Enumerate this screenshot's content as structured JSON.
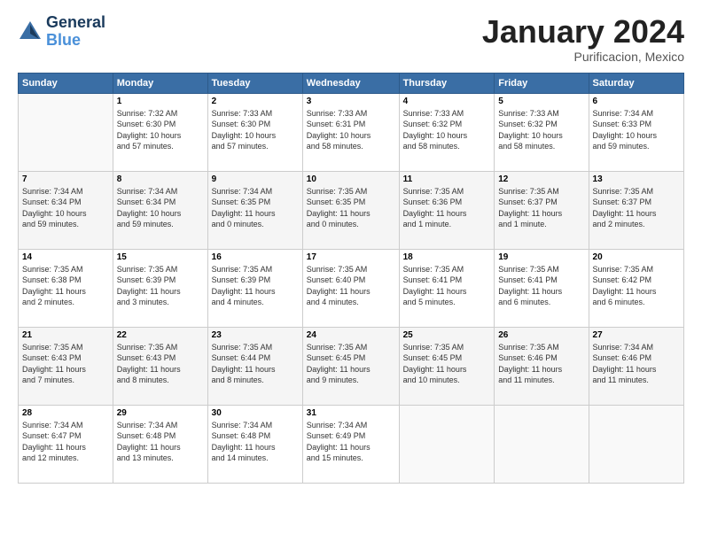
{
  "header": {
    "logo_line1": "General",
    "logo_line2": "Blue",
    "month": "January 2024",
    "location": "Purificacion, Mexico"
  },
  "weekdays": [
    "Sunday",
    "Monday",
    "Tuesday",
    "Wednesday",
    "Thursday",
    "Friday",
    "Saturday"
  ],
  "weeks": [
    [
      {
        "day": "",
        "info": ""
      },
      {
        "day": "1",
        "info": "Sunrise: 7:32 AM\nSunset: 6:30 PM\nDaylight: 10 hours\nand 57 minutes."
      },
      {
        "day": "2",
        "info": "Sunrise: 7:33 AM\nSunset: 6:30 PM\nDaylight: 10 hours\nand 57 minutes."
      },
      {
        "day": "3",
        "info": "Sunrise: 7:33 AM\nSunset: 6:31 PM\nDaylight: 10 hours\nand 58 minutes."
      },
      {
        "day": "4",
        "info": "Sunrise: 7:33 AM\nSunset: 6:32 PM\nDaylight: 10 hours\nand 58 minutes."
      },
      {
        "day": "5",
        "info": "Sunrise: 7:33 AM\nSunset: 6:32 PM\nDaylight: 10 hours\nand 58 minutes."
      },
      {
        "day": "6",
        "info": "Sunrise: 7:34 AM\nSunset: 6:33 PM\nDaylight: 10 hours\nand 59 minutes."
      }
    ],
    [
      {
        "day": "7",
        "info": "Sunrise: 7:34 AM\nSunset: 6:34 PM\nDaylight: 10 hours\nand 59 minutes."
      },
      {
        "day": "8",
        "info": "Sunrise: 7:34 AM\nSunset: 6:34 PM\nDaylight: 10 hours\nand 59 minutes."
      },
      {
        "day": "9",
        "info": "Sunrise: 7:34 AM\nSunset: 6:35 PM\nDaylight: 11 hours\nand 0 minutes."
      },
      {
        "day": "10",
        "info": "Sunrise: 7:35 AM\nSunset: 6:35 PM\nDaylight: 11 hours\nand 0 minutes."
      },
      {
        "day": "11",
        "info": "Sunrise: 7:35 AM\nSunset: 6:36 PM\nDaylight: 11 hours\nand 1 minute."
      },
      {
        "day": "12",
        "info": "Sunrise: 7:35 AM\nSunset: 6:37 PM\nDaylight: 11 hours\nand 1 minute."
      },
      {
        "day": "13",
        "info": "Sunrise: 7:35 AM\nSunset: 6:37 PM\nDaylight: 11 hours\nand 2 minutes."
      }
    ],
    [
      {
        "day": "14",
        "info": "Sunrise: 7:35 AM\nSunset: 6:38 PM\nDaylight: 11 hours\nand 2 minutes."
      },
      {
        "day": "15",
        "info": "Sunrise: 7:35 AM\nSunset: 6:39 PM\nDaylight: 11 hours\nand 3 minutes."
      },
      {
        "day": "16",
        "info": "Sunrise: 7:35 AM\nSunset: 6:39 PM\nDaylight: 11 hours\nand 4 minutes."
      },
      {
        "day": "17",
        "info": "Sunrise: 7:35 AM\nSunset: 6:40 PM\nDaylight: 11 hours\nand 4 minutes."
      },
      {
        "day": "18",
        "info": "Sunrise: 7:35 AM\nSunset: 6:41 PM\nDaylight: 11 hours\nand 5 minutes."
      },
      {
        "day": "19",
        "info": "Sunrise: 7:35 AM\nSunset: 6:41 PM\nDaylight: 11 hours\nand 6 minutes."
      },
      {
        "day": "20",
        "info": "Sunrise: 7:35 AM\nSunset: 6:42 PM\nDaylight: 11 hours\nand 6 minutes."
      }
    ],
    [
      {
        "day": "21",
        "info": "Sunrise: 7:35 AM\nSunset: 6:43 PM\nDaylight: 11 hours\nand 7 minutes."
      },
      {
        "day": "22",
        "info": "Sunrise: 7:35 AM\nSunset: 6:43 PM\nDaylight: 11 hours\nand 8 minutes."
      },
      {
        "day": "23",
        "info": "Sunrise: 7:35 AM\nSunset: 6:44 PM\nDaylight: 11 hours\nand 8 minutes."
      },
      {
        "day": "24",
        "info": "Sunrise: 7:35 AM\nSunset: 6:45 PM\nDaylight: 11 hours\nand 9 minutes."
      },
      {
        "day": "25",
        "info": "Sunrise: 7:35 AM\nSunset: 6:45 PM\nDaylight: 11 hours\nand 10 minutes."
      },
      {
        "day": "26",
        "info": "Sunrise: 7:35 AM\nSunset: 6:46 PM\nDaylight: 11 hours\nand 11 minutes."
      },
      {
        "day": "27",
        "info": "Sunrise: 7:34 AM\nSunset: 6:46 PM\nDaylight: 11 hours\nand 11 minutes."
      }
    ],
    [
      {
        "day": "28",
        "info": "Sunrise: 7:34 AM\nSunset: 6:47 PM\nDaylight: 11 hours\nand 12 minutes."
      },
      {
        "day": "29",
        "info": "Sunrise: 7:34 AM\nSunset: 6:48 PM\nDaylight: 11 hours\nand 13 minutes."
      },
      {
        "day": "30",
        "info": "Sunrise: 7:34 AM\nSunset: 6:48 PM\nDaylight: 11 hours\nand 14 minutes."
      },
      {
        "day": "31",
        "info": "Sunrise: 7:34 AM\nSunset: 6:49 PM\nDaylight: 11 hours\nand 15 minutes."
      },
      {
        "day": "",
        "info": ""
      },
      {
        "day": "",
        "info": ""
      },
      {
        "day": "",
        "info": ""
      }
    ]
  ]
}
